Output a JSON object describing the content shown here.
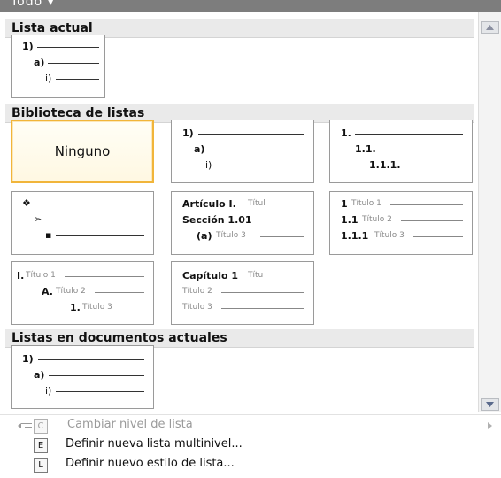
{
  "gallery": {
    "filter_label": "Todo ▾",
    "sections": {
      "current": "Lista actual",
      "library": "Biblioteca de listas",
      "documents": "Listas en documentos actuales"
    }
  },
  "tiles": {
    "current": {
      "l1": "1)",
      "l2": "a)",
      "l3": "i)"
    },
    "none": {
      "label": "Ninguno"
    },
    "numbered": {
      "l1": "1)",
      "l2": "a)",
      "l3": "i)"
    },
    "legal": {
      "l1": "1.",
      "l2": "1.1.",
      "l3": "1.1.1."
    },
    "bullets": {
      "l1": "❖",
      "l2": "➢",
      "l3": "▪"
    },
    "article": {
      "l1_bold": "Artículo I.",
      "l1_gray": "Títul",
      "l2_bold": "Sección 1.01",
      "l3_bold": "(a)",
      "l3_gray": "Título 3"
    },
    "headings": {
      "l1_bold": "1",
      "l1_gray": "Título 1",
      "l2_bold": "1.1",
      "l2_gray": "Título 2",
      "l3_bold": "1.1.1",
      "l3_gray": "Título 3"
    },
    "outline": {
      "l1_bold": "I.",
      "l1_gray": "Título 1",
      "l2_bold": "A.",
      "l2_gray": "Título 2",
      "l3_bold": "1.",
      "l3_gray": "Título 3"
    },
    "chapter": {
      "l1_bold": "Capítulo 1",
      "l1_gray": "Títu",
      "l2_gray": "Título 2",
      "l3_gray": "Título 3"
    },
    "doc": {
      "l1": "1)",
      "l2": "a)",
      "l3": "i)"
    }
  },
  "menu": {
    "change_level": {
      "label": "Cambiar nivel de lista",
      "key": "C",
      "enabled": false
    },
    "define_multilevel": {
      "label": "Definir nueva lista multinivel...",
      "key": "E"
    },
    "define_style": {
      "label": "Definir nuevo estilo de lista...",
      "key": "L"
    }
  },
  "colors": {
    "selected_border": "#f1b53a",
    "header_bg": "#eaeaea"
  }
}
